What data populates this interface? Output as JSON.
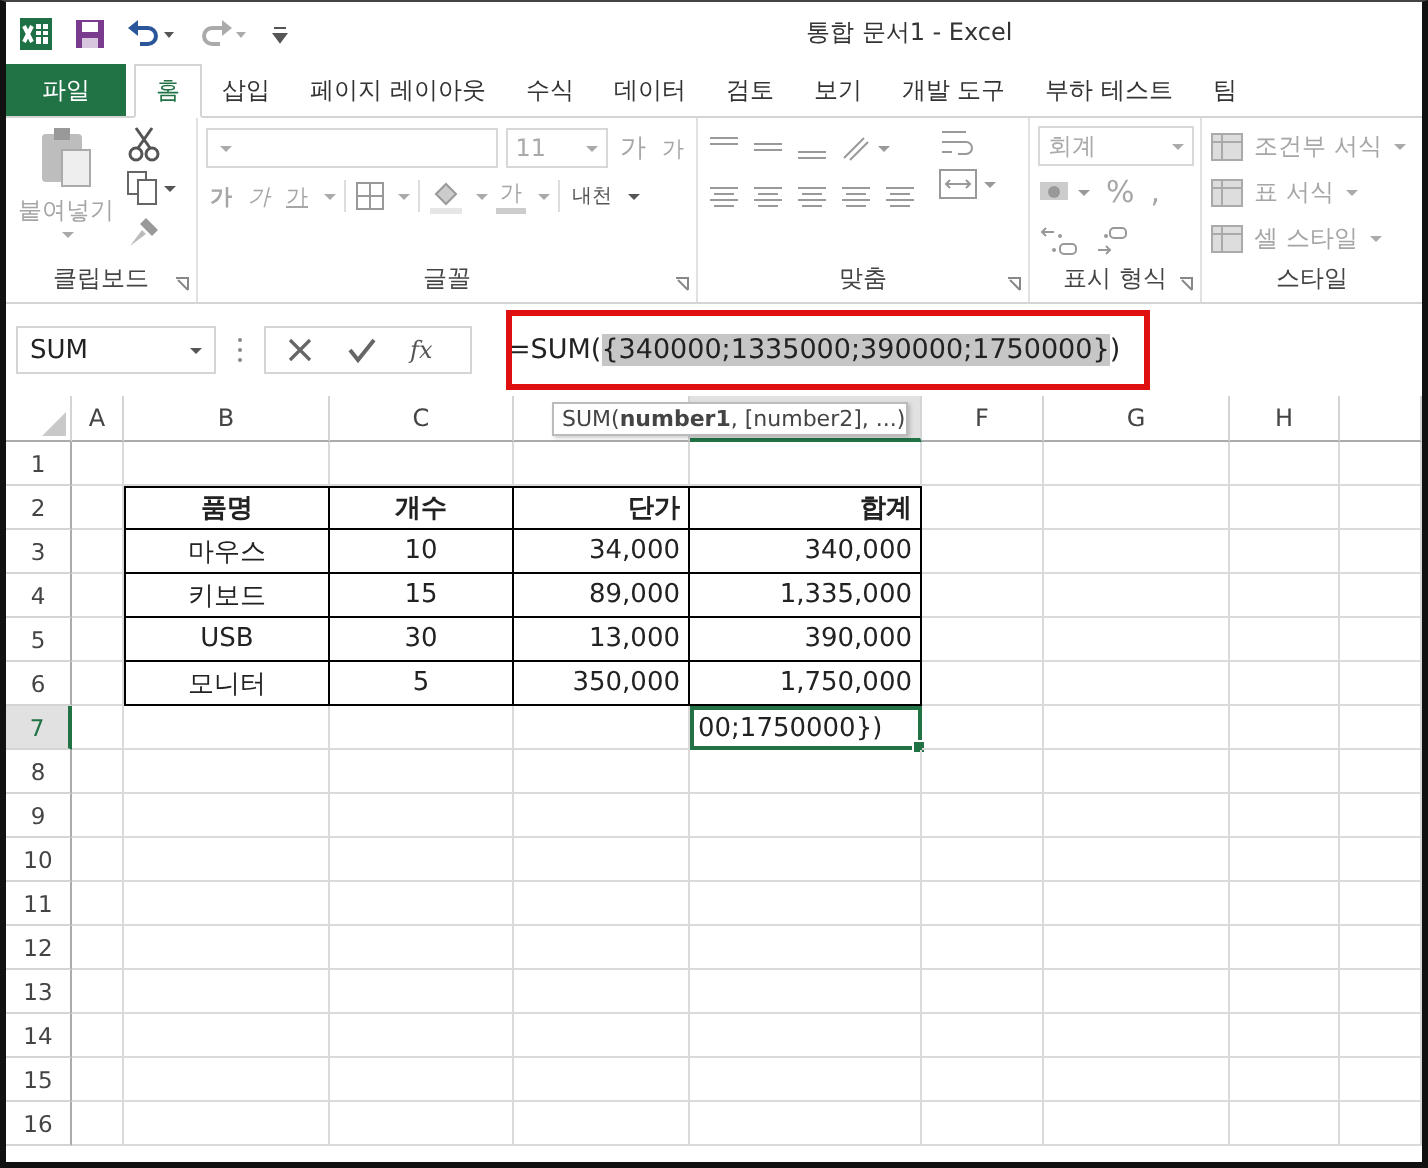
{
  "window": {
    "title": "통합 문서1 - Excel"
  },
  "tabs": [
    {
      "label": "파일",
      "kind": "file",
      "selected": false
    },
    {
      "label": "홈",
      "kind": "tab",
      "selected": true
    },
    {
      "label": "삽입",
      "kind": "tab",
      "selected": false
    },
    {
      "label": "페이지 레이아웃",
      "kind": "tab",
      "selected": false
    },
    {
      "label": "수식",
      "kind": "tab",
      "selected": false
    },
    {
      "label": "데이터",
      "kind": "tab",
      "selected": false
    },
    {
      "label": "검토",
      "kind": "tab",
      "selected": false
    },
    {
      "label": "보기",
      "kind": "tab",
      "selected": false
    },
    {
      "label": "개발 도구",
      "kind": "tab",
      "selected": false
    },
    {
      "label": "부하 테스트",
      "kind": "tab",
      "selected": false
    },
    {
      "label": "팀",
      "kind": "tab",
      "selected": false
    }
  ],
  "ribbon": {
    "disabled": true,
    "clipboard": {
      "label": "클립보드",
      "paste": "붙여넣기"
    },
    "font": {
      "label": "글꼴",
      "size": "11",
      "grow": "가",
      "shrink": "가",
      "bold": "가",
      "italic": "가",
      "underline": "가",
      "font_color": "가",
      "phonetic": "내천"
    },
    "alignment": {
      "label": "맞춤"
    },
    "number": {
      "label": "표시 형식",
      "format": "회계",
      "percent": "%",
      "comma": ","
    },
    "styles": {
      "label": "스타일",
      "items": [
        "조건부 서식",
        "표 서식",
        "셀 스타일"
      ]
    }
  },
  "formula_bar": {
    "name_box": "SUM",
    "fx": "fx",
    "prefix": "=SUM(",
    "selected_text": "{340000;1335000;390000;1750000}",
    "suffix": ")"
  },
  "tooltip": "SUM(**number1**, [number2], ...)",
  "sheet": {
    "columns": [
      {
        "label": "A",
        "selected": false
      },
      {
        "label": "B",
        "selected": false
      },
      {
        "label": "C",
        "selected": false
      },
      {
        "selected": false
      },
      {
        "selected": true
      },
      {
        "label": "F",
        "selected": false
      },
      {
        "label": "G",
        "selected": false
      },
      {
        "label": "H",
        "selected": false
      }
    ],
    "rows": [
      {
        "label": "1",
        "selected": false
      },
      {
        "label": "2",
        "selected": false
      },
      {
        "label": "3",
        "selected": false
      },
      {
        "label": "4",
        "selected": false
      },
      {
        "label": "5",
        "selected": false
      },
      {
        "label": "6",
        "selected": false
      },
      {
        "label": "7",
        "selected": true
      },
      {
        "label": "8",
        "selected": false
      },
      {
        "label": "9",
        "selected": false
      },
      {
        "label": "10",
        "selected": false
      },
      {
        "label": "11",
        "selected": false
      },
      {
        "label": "12",
        "selected": false
      },
      {
        "label": "13",
        "selected": false
      },
      {
        "label": "14",
        "selected": false
      },
      {
        "label": "15",
        "selected": false
      },
      {
        "label": "16",
        "selected": false
      }
    ],
    "edit_text": "00;1750000})"
  },
  "table": {
    "columns": [
      "품명",
      "개수",
      "단가",
      "합계"
    ],
    "rows": [
      [
        "마우스",
        "10",
        "34,000",
        "340,000"
      ],
      [
        "키보드",
        "15",
        "89,000",
        "1,335,000"
      ],
      [
        "USB",
        "30",
        "13,000",
        "390,000"
      ],
      [
        "모니터",
        "5",
        "350,000",
        "1,750,000"
      ]
    ]
  }
}
